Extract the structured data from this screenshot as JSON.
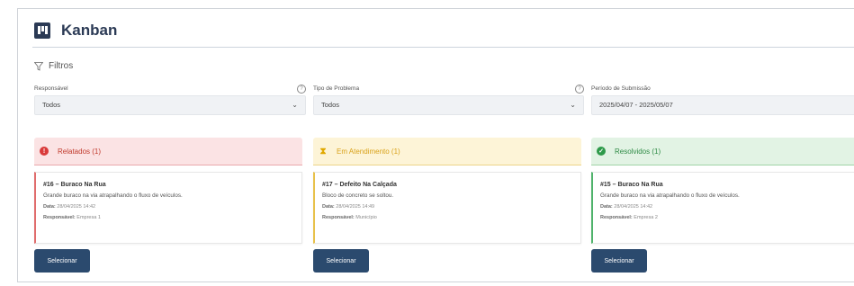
{
  "app": {
    "title": "Kanban"
  },
  "filters": {
    "heading": "Filtros",
    "responsavel": {
      "label": "Responsável",
      "value": "Todos"
    },
    "tipo": {
      "label": "Tipo de Problema",
      "value": "Todos"
    },
    "periodo": {
      "label": "Período de Submissão",
      "value": "2025/04/07 - 2025/05/07"
    }
  },
  "columns": [
    {
      "title": "Relatados (1)",
      "icon": "alert-circle-icon",
      "color": "#d93a3a",
      "card": {
        "title": "#16 – Buraco Na Rua",
        "description": "Grande buraco na via atrapalhando o fluxo de veículos.",
        "date_label": "Data:",
        "date": "28/04/2025 14:42",
        "resp_label": "Responsável:",
        "resp": "Empresa 1"
      },
      "button": "Selecionar"
    },
    {
      "title": "Em Atendimento (1)",
      "icon": "hourglass-icon",
      "color": "#e0a800",
      "card": {
        "title": "#17 – Defeito Na Calçada",
        "description": "Bloco de concreto se soltou.",
        "date_label": "Data:",
        "date": "28/04/2025 14:49",
        "resp_label": "Responsável:",
        "resp": "Município"
      },
      "button": "Selecionar"
    },
    {
      "title": "Resolvidos (1)",
      "icon": "check-circle-icon",
      "color": "#2e9a4a",
      "card": {
        "title": "#15 – Buraco Na Rua",
        "description": "Grande buraco na via atrapalhando o fluxo de veículos.",
        "date_label": "Data:",
        "date": "28/04/2025 14:42",
        "resp_label": "Responsável:",
        "resp": "Empresa 2"
      },
      "button": "Selecionar"
    }
  ]
}
